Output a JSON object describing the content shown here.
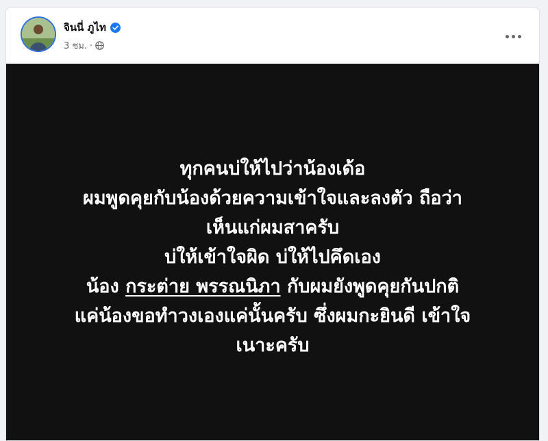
{
  "post": {
    "author_name": "จินนี่ ภูไท",
    "timestamp": "3 ชม. ·",
    "verified_icon": "verified-badge-icon",
    "privacy_icon": "globe-icon",
    "more_icon": "more-options-icon",
    "accent_color": "#1877f2"
  },
  "image_text": {
    "line1": "ทุกคนบ่ให้ไปว่าน้องเด้อ",
    "line2": "ผมพูดคุยกับน้องด้วยความเข้าใจและลงตัว ถือว่า",
    "line3": "เห็นแก่ผมสาครับ",
    "line4": "บ่ให้เข้าใจผิด บ่ให้ไปคึดเอง",
    "line5_prefix": "น้อง ",
    "line5_mention": "กระต่าย พรรณนิภา",
    "line5_suffix": " กับผมยังพูดคุยกันปกติ",
    "line6": "แค่น้องขอทำวงเองแค่นั้นครับ ซึ่งผมกะยินดี เข้าใจ",
    "line7": "เนาะครับ"
  }
}
